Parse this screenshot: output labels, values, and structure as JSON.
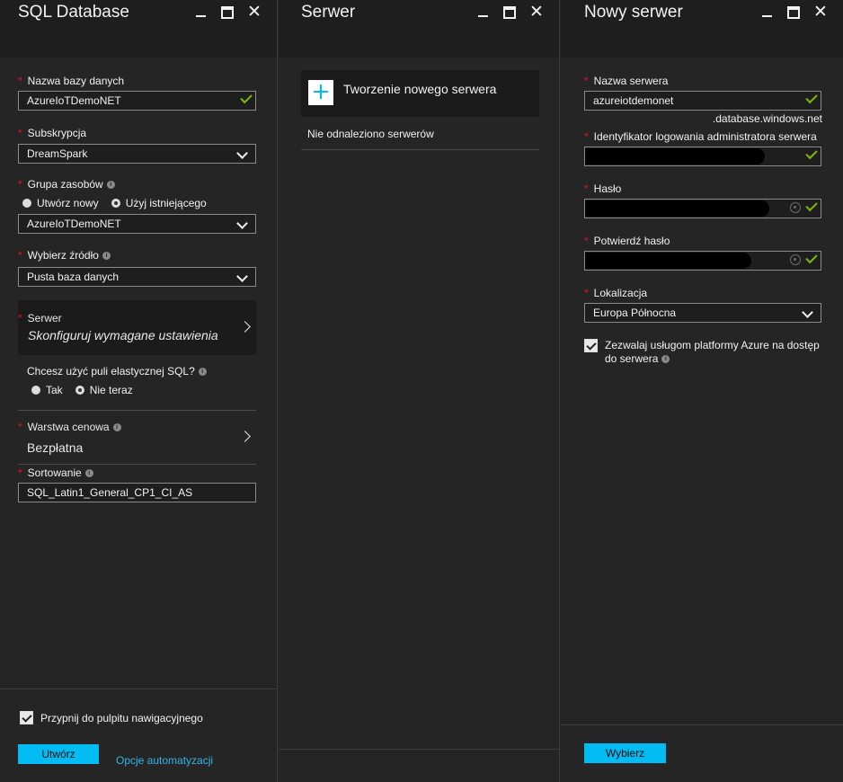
{
  "blade1": {
    "title": "SQL Database",
    "db_name_label": "Nazwa bazy danych",
    "db_name_value": "AzureIoTDemoNET",
    "subscription_label": "Subskrypcja",
    "subscription_value": "DreamSpark",
    "resource_group_label": "Grupa zasobów",
    "rg_option_new": "Utwórz nowy",
    "rg_option_existing": "Użyj istniejącego",
    "rg_selected": "Użyj istniejącego",
    "resource_group_value": "AzureIoTDemoNET",
    "source_label": "Wybierz źródło",
    "source_value": "Pusta baza danych",
    "server_label": "Serwer",
    "server_value": "Skonfiguruj wymagane ustawienia",
    "elastic_label": "Chcesz użyć puli elastycznej SQL?",
    "elastic_yes": "Tak",
    "elastic_no": "Nie teraz",
    "elastic_selected": "Nie teraz",
    "pricing_label": "Warstwa cenowa",
    "pricing_value": "Bezpłatna",
    "collation_label": "Sortowanie",
    "collation_value": "SQL_Latin1_General_CP1_CI_AS",
    "pin_label": "Przypnij do pulpitu nawigacyjnego",
    "pin_checked": true,
    "create_button": "Utwórz",
    "automation_link": "Opcje automatyzacji"
  },
  "blade2": {
    "title": "Serwer",
    "create_new": "Tworzenie nowego serwera",
    "no_servers": "Nie odnaleziono serwerów"
  },
  "blade3": {
    "title": "Nowy serwer",
    "server_name_label": "Nazwa serwera",
    "server_name_value": "azureiotdemonet",
    "server_suffix": ".database.windows.net",
    "admin_label": "Identyfikator logowania administratora serwera",
    "password_label": "Hasło",
    "confirm_label": "Potwierdź hasło",
    "location_label": "Lokalizacja",
    "location_value": "Europa Północna",
    "allow_azure_label": "Zezwalaj usługom platformy Azure na dostęp do serwera",
    "allow_azure_checked": true,
    "select_button": "Wybierz"
  },
  "colors": {
    "background": "#252526",
    "header": "#1e1e1e",
    "accent": "#00bcf2",
    "valid": "#7fba00",
    "required": "#e81123",
    "link": "#33b5e5"
  },
  "icons": [
    "minimize-icon",
    "maximize-icon",
    "close-icon",
    "checkmark-icon",
    "chevron-down-icon",
    "chevron-right-icon",
    "info-icon",
    "plus-icon",
    "eye-icon"
  ]
}
